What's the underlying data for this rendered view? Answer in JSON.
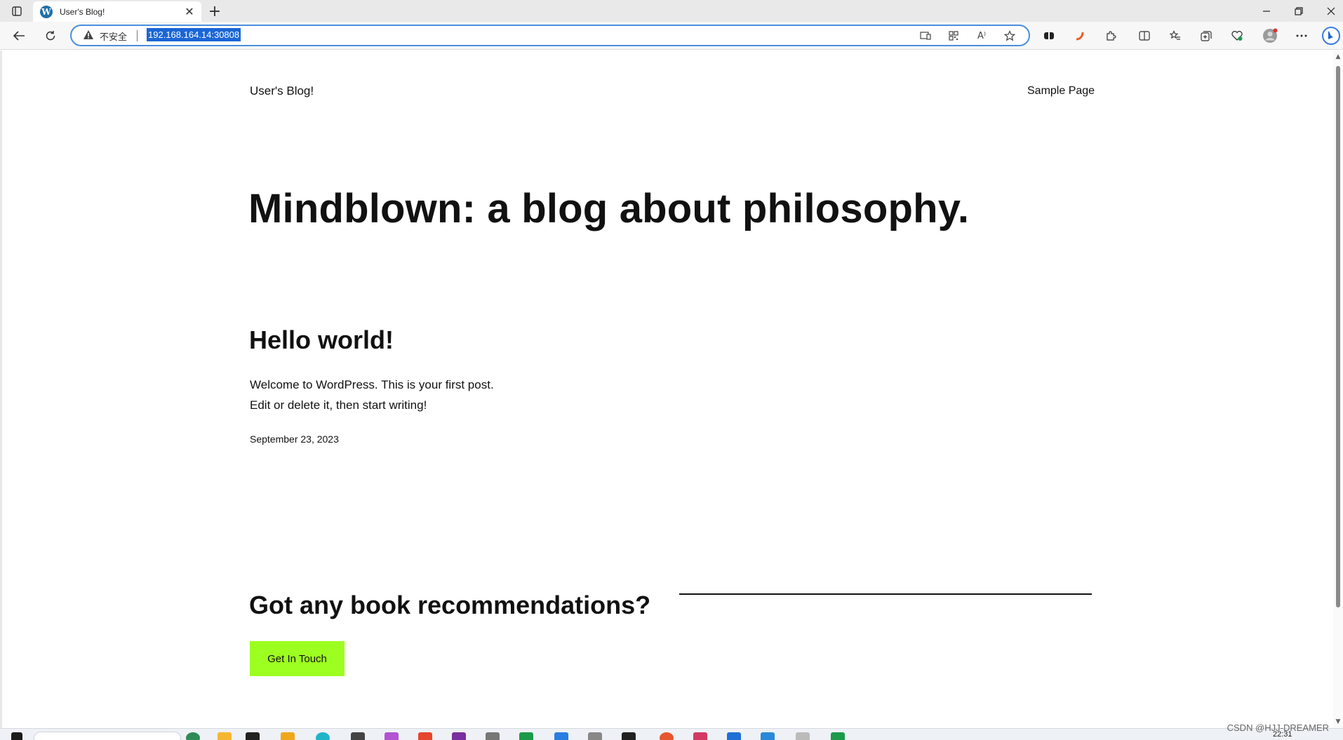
{
  "browser": {
    "tab_title": "User's Blog!",
    "tab_favicon": "W",
    "new_tab_symbol": "+",
    "insecure_label": "不安全",
    "url": "192.168.164.14:30808",
    "icons": {
      "back": "back-arrow-icon",
      "refresh": "refresh-icon",
      "warning": "warning-triangle-icon",
      "read_aloud": "A⁾"
    }
  },
  "page": {
    "site_title": "User's Blog!",
    "nav_link": "Sample Page",
    "hero_heading": "Mindblown: a blog about philosophy.",
    "post": {
      "title": "Hello world!",
      "excerpt_line1": "Welcome to WordPress. This is your first post.",
      "excerpt_line2": "Edit or delete it, then start writing!",
      "date": "September 23, 2023"
    },
    "cta": {
      "heading": "Got any book recommendations?",
      "button_label": "Get In Touch",
      "button_color": "#9dff20"
    }
  },
  "system": {
    "watermark": "CSDN @HJJ-DREAMER",
    "clock": "22:31"
  }
}
